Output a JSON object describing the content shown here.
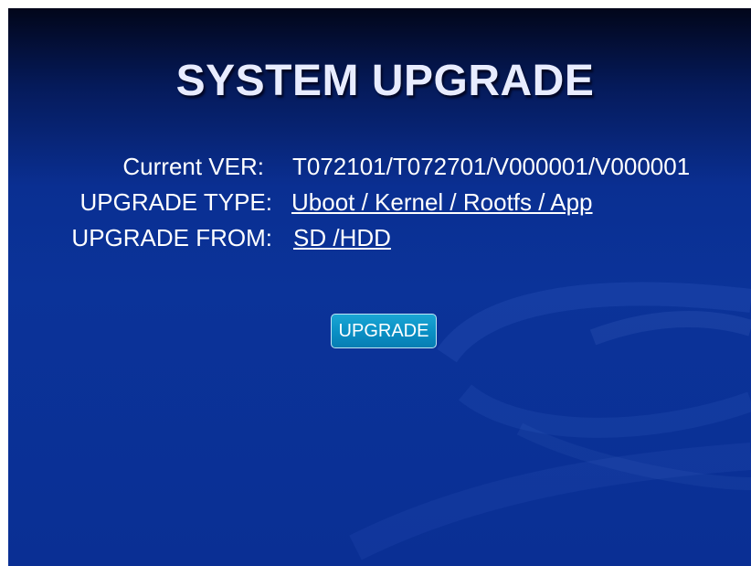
{
  "page": {
    "title": "SYSTEM UPGRADE"
  },
  "info": {
    "current_ver_label": "Current VER:",
    "current_ver_value": "T072101/T072701/V000001/V000001",
    "upgrade_type_label": "UPGRADE TYPE:",
    "upgrade_type_value": "Uboot / Kernel / Rootfs / App",
    "upgrade_from_label": "UPGRADE FROM:",
    "upgrade_from_value": "SD /HDD"
  },
  "actions": {
    "upgrade_button_label": "UPGRADE"
  },
  "colors": {
    "background_top": "#02061a",
    "background_main": "#0b3399",
    "button": "#0a8fc4",
    "text": "#ffffff"
  }
}
